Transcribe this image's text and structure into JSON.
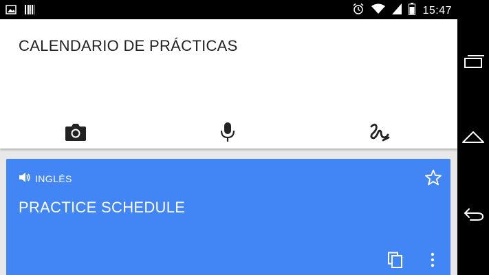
{
  "status_bar": {
    "time": "15:47",
    "left_icons": [
      "image-icon",
      "barcode-icon"
    ],
    "right_icons": [
      "alarm-icon",
      "wifi-icon",
      "signal-icon",
      "battery-icon"
    ]
  },
  "source": {
    "text": "CALENDARIO DE PRÁCTICAS",
    "input_icons": [
      "camera-icon",
      "microphone-icon",
      "handwriting-icon"
    ]
  },
  "result": {
    "language": "INGLÉS",
    "text": "PRACTICE SCHEDULE",
    "accent_color": "#4285f4",
    "icons": [
      "speaker-icon",
      "star-icon",
      "copy-icon",
      "more-icon"
    ]
  },
  "nav_bar": {
    "icons": [
      "recent-apps-icon",
      "home-icon",
      "back-icon"
    ]
  }
}
